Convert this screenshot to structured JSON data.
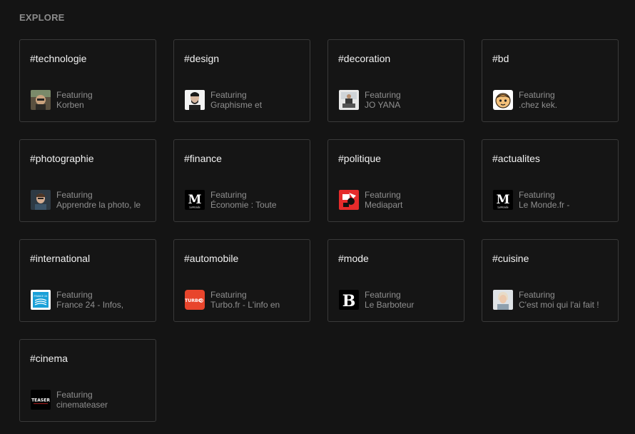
{
  "explore": {
    "title": "EXPLORE",
    "cards": [
      {
        "tag": "#technologie",
        "featuring": "Featuring",
        "source": "Korben",
        "icon": "korben-avatar-icon"
      },
      {
        "tag": "#design",
        "featuring": "Featuring",
        "source": "Graphisme et",
        "icon": "graphisme-avatar-icon"
      },
      {
        "tag": "#decoration",
        "featuring": "Featuring",
        "source": "JO YANA",
        "icon": "joyana-avatar-icon"
      },
      {
        "tag": "#bd",
        "featuring": "Featuring",
        "source": ".chez kek.",
        "icon": "chezkek-avatar-icon"
      },
      {
        "tag": "#photographie",
        "featuring": "Featuring",
        "source": "Apprendre la photo, le",
        "icon": "apprendre-photo-avatar-icon"
      },
      {
        "tag": "#finance",
        "featuring": "Featuring",
        "source": "Économie : Toute",
        "icon": "lemonde-logo-icon"
      },
      {
        "tag": "#politique",
        "featuring": "Featuring",
        "source": "Mediapart",
        "icon": "mediapart-logo-icon"
      },
      {
        "tag": "#actualites",
        "featuring": "Featuring",
        "source": "Le Monde.fr -",
        "icon": "lemonde-logo-icon"
      },
      {
        "tag": "#international",
        "featuring": "Featuring",
        "source": "France 24 - Infos,",
        "icon": "france24-logo-icon"
      },
      {
        "tag": "#automobile",
        "featuring": "Featuring",
        "source": "Turbo.fr - L'info en",
        "icon": "turbo-logo-icon"
      },
      {
        "tag": "#mode",
        "featuring": "Featuring",
        "source": "Le Barboteur",
        "icon": "barboteur-logo-icon"
      },
      {
        "tag": "#cuisine",
        "featuring": "Featuring",
        "source": "C'est moi qui l'ai fait !",
        "icon": "cuisine-avatar-icon"
      },
      {
        "tag": "#cinema",
        "featuring": "Featuring",
        "source": "cinemateaser",
        "icon": "teaser-logo-icon"
      }
    ],
    "logo_text": {
      "lemonde": "M",
      "lemonde_small": "LeMonde",
      "france24": "FRANCE 24",
      "turbo": "TURBO",
      "barboteur": "B",
      "teaser": "TEASER"
    }
  }
}
